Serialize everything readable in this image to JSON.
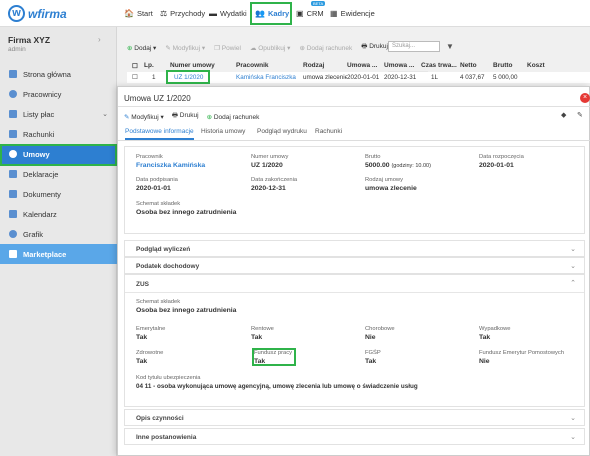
{
  "topbar": {
    "logo": "wfirma",
    "nav": [
      "Start",
      "Przychody",
      "Wydatki",
      "Kadry",
      "CRM",
      "Ewidencje"
    ],
    "beta": "BETA"
  },
  "sidebar": {
    "company": "Firma XYZ",
    "user": "admin",
    "items": [
      "Strona główna",
      "Pracownicy",
      "Listy płac",
      "Rachunki",
      "Umowy",
      "Deklaracje",
      "Dokumenty",
      "Kalendarz",
      "Grafik",
      "Marketplace"
    ]
  },
  "list_toolbar": {
    "dodaj": "Dodaj",
    "modyfikuj": "Modyfikuj",
    "powiel": "Powiel",
    "opublikuj": "Opublikuj",
    "dodaj_rachunek": "Dodaj rachunek",
    "drukuj": "Drukuj",
    "search_placeholder": "Szukaj..."
  },
  "table": {
    "headers": [
      "Lp.",
      "Numer umowy",
      "Pracownik",
      "Rodzaj",
      "Umowa ...",
      "Umowa ...",
      "Czas trwa...",
      "Netto",
      "Brutto",
      "Koszt"
    ],
    "row": [
      "1",
      "UZ 1/2020",
      "Kamińska Franciszka",
      "umowa zlecenie",
      "2020-01-01",
      "2020-12-31",
      "1L",
      "4 037,67",
      "5 000,00",
      ""
    ]
  },
  "modal": {
    "title": "Umowa UZ 1/2020",
    "tools": {
      "modyfikuj": "Modyfikuj",
      "drukuj": "Drukuj",
      "dodaj_rachunek": "Dodaj rachunek"
    },
    "tabs": [
      "Podstawowe informacje",
      "Historia umowy",
      "Podgląd wydruku",
      "Rachunki"
    ],
    "info": {
      "pracownik_l": "Pracownik",
      "pracownik_v": "Franciszka Kamińska",
      "numer_l": "Numer umowy",
      "numer_v": "UZ 1/2020",
      "brutto_l": "Brutto",
      "brutto_v": "5000.00",
      "brutto_note": "(godziny: 10.00)",
      "rozp_l": "Data rozpoczęcia",
      "rozp_v": "2020-01-01",
      "podp_l": "Data podpisania",
      "podp_v": "2020-01-01",
      "zak_l": "Data zakończenia",
      "zak_v": "2020-12-31",
      "rodzaj_l": "Rodzaj umowy",
      "rodzaj_v": "umowa zlecenie",
      "schemat_l": "Schemat składek",
      "schemat_v": "Osoba bez innego zatrudnienia"
    },
    "sections": [
      "Podgląd wyliczeń",
      "Podatek dochodowy",
      "ZUS",
      "Opis czynności",
      "Inne postanowienia"
    ],
    "zus": {
      "schemat_l": "Schemat składek",
      "schemat_v": "Osoba bez innego zatrudnienia",
      "emer_l": "Emerytalne",
      "emer_v": "Tak",
      "rent_l": "Rentowe",
      "rent_v": "Tak",
      "chor_l": "Chorobowe",
      "chor_v": "Nie",
      "wyp_l": "Wypadkowe",
      "wyp_v": "Tak",
      "zdr_l": "Zdrowotne",
      "zdr_v": "Tak",
      "fp_l": "Fundusz pracy",
      "fp_v": "Tak",
      "fgsp_l": "FGŚP",
      "fgsp_v": "Tak",
      "fep_l": "Fundusz Emerytur Pomostowych",
      "fep_v": "Nie",
      "kod_l": "Kod tytułu ubezpieczenia",
      "kod_v": "04 11 - osoba wykonująca umowę agencyjną, umowę zlecenia lub umowę o świadczenie usług"
    }
  }
}
